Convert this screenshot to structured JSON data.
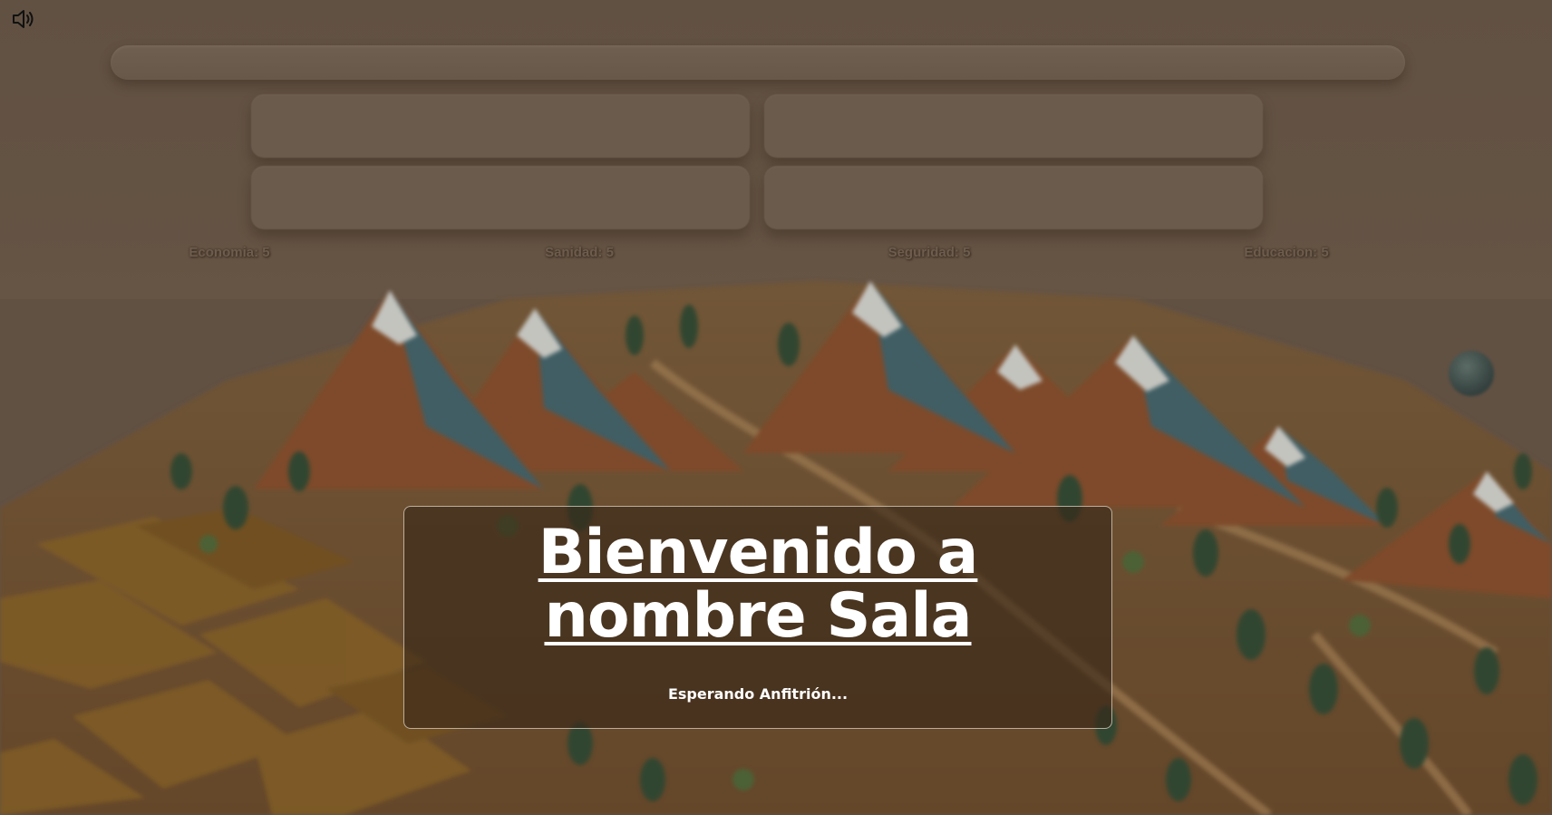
{
  "sound": {
    "icon": "speaker-icon",
    "state": "on"
  },
  "stats": [
    {
      "label": "Economia: 5"
    },
    {
      "label": "Sanidad: 5"
    },
    {
      "label": "Seguridad: 5"
    },
    {
      "label": "Educacion: 5"
    }
  ],
  "welcome": {
    "title_line1": "Bienvenido a",
    "title_line2": "nombre Sala",
    "status": "Esperando Anfitrión..."
  },
  "colors": {
    "background": "#67574a",
    "modal_border": "#e1d7c8",
    "text": "#ffffff"
  }
}
